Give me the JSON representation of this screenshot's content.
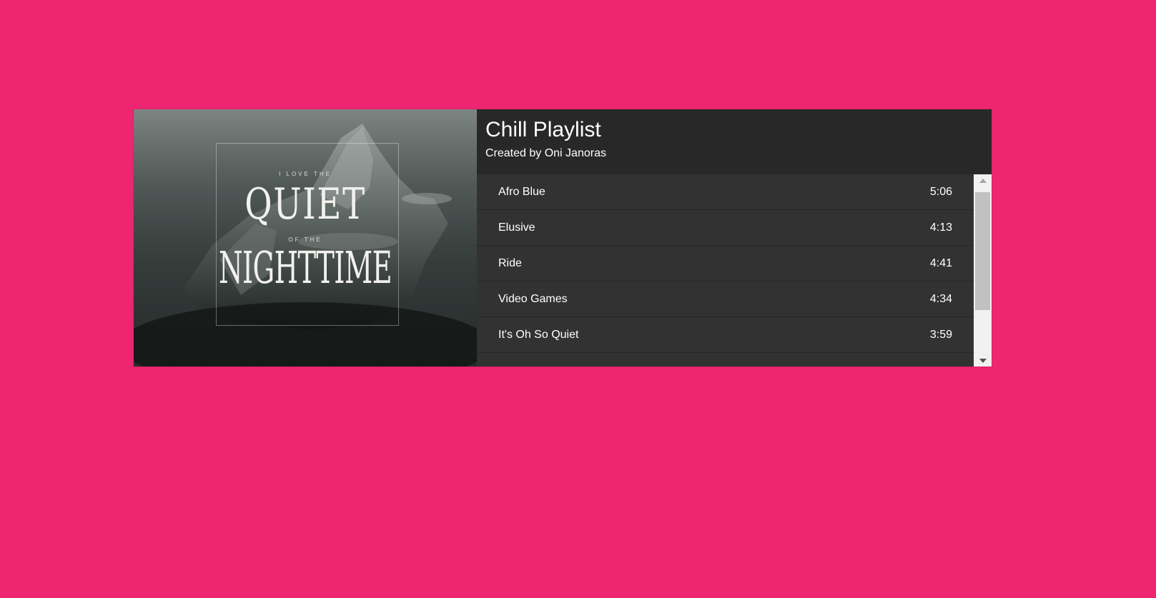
{
  "playlist": {
    "title": "Chill Playlist",
    "subtitle": "Created by Oni Janoras"
  },
  "cover": {
    "line1": "I LOVE THE",
    "line2": "QUIET",
    "line3": "OF THE",
    "line4": "NIGHTTIME"
  },
  "tracks": [
    {
      "name": "Afro Blue",
      "duration": "5:06"
    },
    {
      "name": "Elusive",
      "duration": "4:13"
    },
    {
      "name": "Ride",
      "duration": "4:41"
    },
    {
      "name": "Video Games",
      "duration": "4:34"
    },
    {
      "name": "It's Oh So Quiet",
      "duration": "3:59"
    }
  ],
  "colors": {
    "page_background": "#ee2570",
    "header_background": "#282828",
    "list_background": "#323232",
    "text": "#ffffff"
  },
  "icons": {
    "scroll_up": "triangle-up",
    "scroll_down": "triangle-down"
  }
}
